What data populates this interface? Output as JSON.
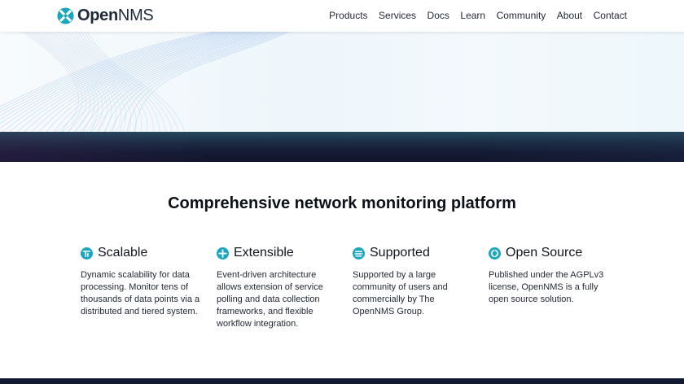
{
  "brand": {
    "open": "Open",
    "nms": "NMS"
  },
  "nav": [
    "Products",
    "Services",
    "Docs",
    "Learn",
    "Community",
    "About",
    "Contact"
  ],
  "section_title": "Comprehensive network monitoring platform",
  "features": [
    {
      "icon": "scalable-icon",
      "title": "Scalable",
      "desc": "Dynamic scalability for data processing. Monitor tens of thousands of data points via a distributed and tiered system."
    },
    {
      "icon": "extensible-icon",
      "title": "Extensible",
      "desc": "Event-driven architecture allows extension of service polling and data collection frameworks, and flexible workflow integration."
    },
    {
      "icon": "supported-icon",
      "title": "Supported",
      "desc": "Supported by a large community of users and commercially by The OpenNMS Group."
    },
    {
      "icon": "open-source-icon",
      "title": "Open Source",
      "desc": "Published under the AGPLv3 license, OpenNMS is a fully open source solution."
    }
  ],
  "colors": {
    "accent": "#1aa6bf",
    "brand_dark": "#1c2a3a",
    "band": "#141a33"
  }
}
